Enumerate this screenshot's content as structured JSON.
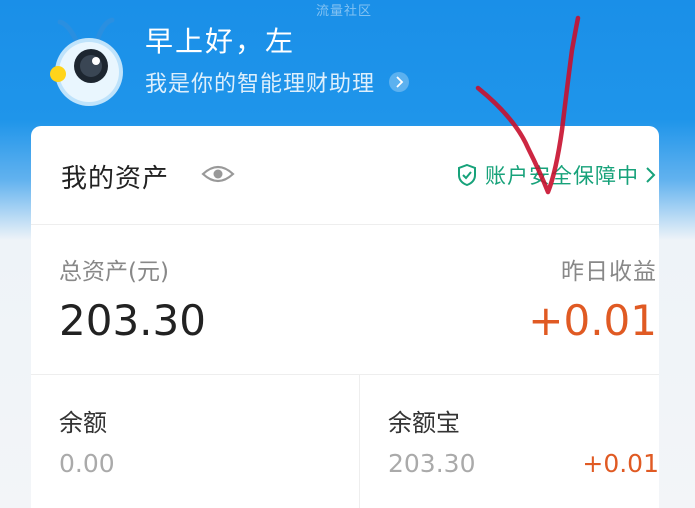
{
  "watermark": "流量社区",
  "header": {
    "greeting": "早上好，左",
    "assistant_text": "我是你的智能理财助理",
    "mascot_icon": "ant-mascot-icon"
  },
  "card": {
    "title": "我的资产",
    "security_label": "账户安全保障中",
    "summary": {
      "total_label": "总资产(元)",
      "total_value": "203.30",
      "yesterday_label": "昨日收益",
      "yesterday_value": "+0.01"
    },
    "balance": {
      "label": "余额",
      "value": "0.00"
    },
    "yuebao": {
      "label": "余额宝",
      "value": "203.30",
      "gain": "+0.01"
    }
  },
  "colors": {
    "header_blue": "#1a8fe8",
    "gain_orange": "#e05a23",
    "security_green": "#17a27a",
    "annotation_red": "#c8102e"
  }
}
